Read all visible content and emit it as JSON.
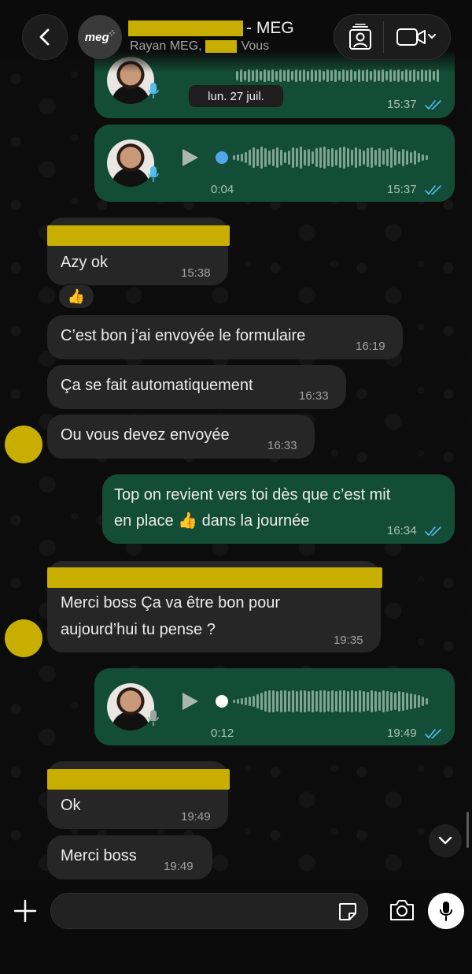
{
  "header": {
    "title_suffix": "- MEG",
    "subtitle_name": "Rayan MEG,",
    "subtitle_you": "Vous",
    "group_avatar_text": "meg",
    "back_icon": "chevron-left-icon",
    "contact_icon": "contact-card-icon",
    "video_icon": "video-camera-icon"
  },
  "date_separator": "lun. 27 juil.",
  "messages": [
    {
      "kind": "voice-out",
      "duration": "",
      "time": "15:37"
    },
    {
      "kind": "voice-out",
      "duration": "0:04",
      "time": "15:37"
    },
    {
      "kind": "text-in",
      "text": "Azy ok",
      "time": "15:38",
      "reaction": "👍"
    },
    {
      "kind": "text-in",
      "text": "C’est bon j’ai envoyée le formulaire",
      "time": "16:19"
    },
    {
      "kind": "text-in",
      "text": "Ça se fait automatiquement",
      "time": "16:33"
    },
    {
      "kind": "text-in",
      "text": "Ou vous devez envoyée",
      "time": "16:33"
    },
    {
      "kind": "text-out",
      "line1": "Top on revient vers toi dès que c’est mit",
      "line2": "en place 👍 dans la journée",
      "time": "16:34"
    },
    {
      "kind": "text-in",
      "line1": "Merci boss Ça va être bon pour",
      "line2": "aujourd’hui tu pense ?",
      "time": "19:35"
    },
    {
      "kind": "voice-out",
      "duration": "0:12",
      "time": "19:49"
    },
    {
      "kind": "text-in",
      "text": "Ok",
      "time": "19:49"
    },
    {
      "kind": "text-in",
      "text": "Merci boss",
      "time": "19:49"
    }
  ],
  "composer": {
    "placeholder": "",
    "plus_icon": "plus-icon",
    "sticker_icon": "sticker-icon",
    "camera_icon": "camera-icon",
    "mic_icon": "microphone-icon"
  },
  "colors": {
    "outgoing_bubble": "#144d37",
    "incoming_bubble": "#262626",
    "redaction": "#c8ae00",
    "read_ticks": "#53bdeb",
    "voice_dot": "#53a6eb"
  }
}
